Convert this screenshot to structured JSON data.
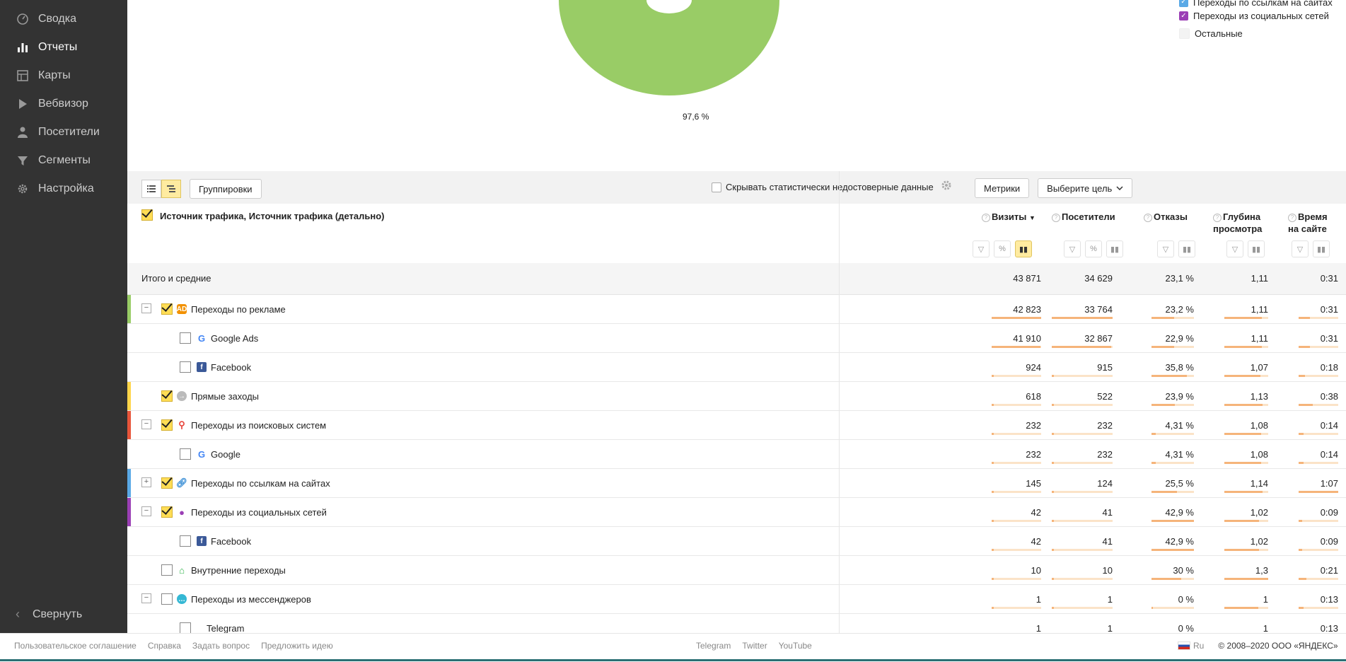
{
  "sidebar": {
    "items": [
      {
        "label": "Сводка",
        "icon": "dashboard-icon"
      },
      {
        "label": "Отчеты",
        "icon": "bar-chart-icon"
      },
      {
        "label": "Карты",
        "icon": "map-icon"
      },
      {
        "label": "Вебвизор",
        "icon": "play-icon"
      },
      {
        "label": "Посетители",
        "icon": "person-icon"
      },
      {
        "label": "Сегменты",
        "icon": "filter-icon"
      },
      {
        "label": "Настройка",
        "icon": "gear-icon"
      }
    ],
    "collapse_label": "Свернуть"
  },
  "chart": {
    "pct_label": "97,6 %",
    "donut_color": "#99cc66",
    "legend": [
      {
        "label": "Переходы по ссылкам на сайтах",
        "color": "#5aa9e6",
        "checked": true
      },
      {
        "label": "Переходы из социальных сетей",
        "color": "#9b3fb5",
        "checked": true
      },
      {
        "label": "Остальные",
        "color": "#eeeeee",
        "checked": false
      }
    ]
  },
  "toolbar": {
    "groupings_label": "Группировки",
    "hide_stat_label": "Скрывать статистически недостоверные данные",
    "metrics_label": "Метрики",
    "goal_label": "Выберите цель"
  },
  "table": {
    "dimension_header": "Источник трафика, Источник трафика (детально)",
    "columns": [
      {
        "label": "Визиты",
        "sort": "▼"
      },
      {
        "label": "Посетители"
      },
      {
        "label": "Отказы"
      },
      {
        "label": "Глубина просмотра"
      },
      {
        "label": "Время на сайте"
      }
    ],
    "total": {
      "label": "Итого и средние",
      "values": [
        "43 871",
        "34 629",
        "23,1 %",
        "1,11",
        "0:31"
      ]
    },
    "rows": [
      {
        "label": "Переходы по рекламе",
        "values": [
          "42 823",
          "33 764",
          "23,2 %",
          "1,11",
          "0:31"
        ]
      },
      {
        "label": "Google Ads",
        "values": [
          "41 910",
          "32 867",
          "22,9 %",
          "1,11",
          "0:31"
        ]
      },
      {
        "label": "Facebook",
        "values": [
          "924",
          "915",
          "35,8 %",
          "1,07",
          "0:18"
        ]
      },
      {
        "label": "Прямые заходы",
        "values": [
          "618",
          "522",
          "23,9 %",
          "1,13",
          "0:38"
        ]
      },
      {
        "label": "Переходы из поисковых систем",
        "values": [
          "232",
          "232",
          "4,31 %",
          "1,08",
          "0:14"
        ]
      },
      {
        "label": "Google",
        "values": [
          "232",
          "232",
          "4,31 %",
          "1,08",
          "0:14"
        ]
      },
      {
        "label": "Переходы по ссылкам на сайтах",
        "values": [
          "145",
          "124",
          "25,5 %",
          "1,14",
          "1:07"
        ]
      },
      {
        "label": "Переходы из социальных сетей",
        "values": [
          "42",
          "41",
          "42,9 %",
          "1,02",
          "0:09"
        ]
      },
      {
        "label": "Facebook",
        "values": [
          "42",
          "41",
          "42,9 %",
          "1,02",
          "0:09"
        ]
      },
      {
        "label": "Внутренние переходы",
        "values": [
          "10",
          "10",
          "30 %",
          "1,3",
          "0:21"
        ]
      },
      {
        "label": "Переходы из мессенджеров",
        "values": [
          "1",
          "1",
          "0 %",
          "1",
          "0:13"
        ]
      },
      {
        "label": "Telegram",
        "values": [
          "1",
          "1",
          "0 %",
          "1",
          "0:13"
        ]
      }
    ]
  },
  "footer": {
    "left": [
      "Пользовательское соглашение",
      "Справка",
      "Задать вопрос",
      "Предложить идею"
    ],
    "middle": [
      "Telegram",
      "Twitter",
      "YouTube"
    ],
    "lang": "Ru",
    "copyright": "© 2008–2020 ООО «ЯНДЕКС»"
  }
}
